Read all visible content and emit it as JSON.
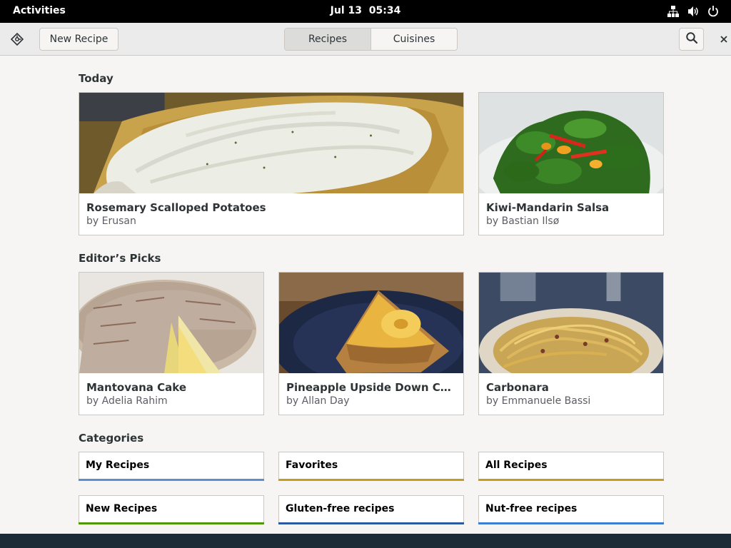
{
  "topbar": {
    "activities": "Activities",
    "date": "Jul 13",
    "time": "05:34"
  },
  "header": {
    "new_recipe": "New Recipe",
    "tabs": [
      {
        "label": "Recipes",
        "active": true
      },
      {
        "label": "Cuisines",
        "active": false
      }
    ]
  },
  "today": {
    "title": "Today",
    "cards": [
      {
        "title": "Rosemary Scalloped Potatoes",
        "author": "by Erusan",
        "image": "scalloped-potatoes"
      },
      {
        "title": "Kiwi-Mandarin Salsa",
        "author": "by Bastian Ilsø",
        "image": "spinach-salad"
      }
    ]
  },
  "editors_picks": {
    "title": "Editor’s Picks",
    "cards": [
      {
        "title": "Mantovana Cake",
        "author": "by Adelia Rahim",
        "image": "mantovana-cake"
      },
      {
        "title": "Pineapple Upside Down Cake with Chocolate",
        "author": "by Allan Day",
        "image": "pineapple-cake"
      },
      {
        "title": "Carbonara",
        "author": "by Emmanuele Bassi",
        "image": "carbonara"
      }
    ]
  },
  "categories": {
    "title": "Categories",
    "items": [
      {
        "label": "My Recipes",
        "color": "#5e8ed2"
      },
      {
        "label": "Favorites",
        "color": "#c59e1c"
      },
      {
        "label": "All Recipes",
        "color": "#c59e1c"
      },
      {
        "label": "New Recipes",
        "color": "#4e9a06"
      },
      {
        "label": "Gluten-free recipes",
        "color": "#2c5aa0"
      },
      {
        "label": "Nut-free recipes",
        "color": "#3d7ed4"
      }
    ]
  }
}
